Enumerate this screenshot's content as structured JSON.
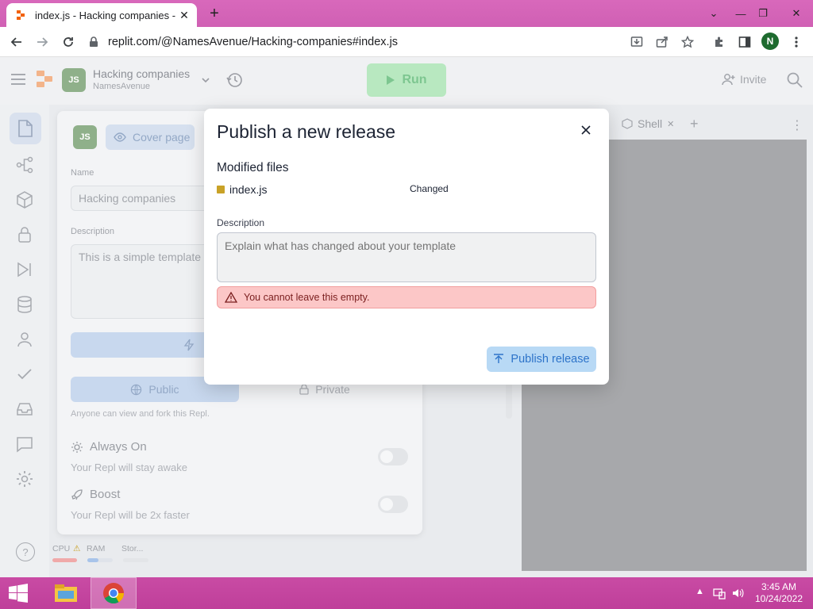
{
  "browser": {
    "tab_title": "index.js - Hacking companies - R",
    "url": "replit.com/@NamesAvenue/Hacking-companies#index.js",
    "profile_initial": "N"
  },
  "app": {
    "repl_title": "Hacking companies",
    "repl_owner": "NamesAvenue",
    "run_label": "Run",
    "invite_label": "Invite",
    "shell_tab": "Shell"
  },
  "panel": {
    "cover_page": "Cover page",
    "name_label": "Name",
    "name_value": "Hacking companies",
    "description_label": "Description",
    "description_value": "This is a simple template",
    "public_label": "Public",
    "private_label": "Private",
    "visibility_note": "Anyone can view and fork this Repl.",
    "always_on_title": "Always On",
    "always_on_sub": "Your Repl will stay awake",
    "boost_title": "Boost",
    "boost_sub": "Your Repl will be 2x faster",
    "cpu": "CPU",
    "ram": "RAM",
    "storage": "Stor..."
  },
  "modal": {
    "title": "Publish a new release",
    "modified_files_label": "Modified files",
    "files": [
      {
        "name": "index.js",
        "status": "Changed"
      }
    ],
    "description_label": "Description",
    "description_placeholder": "Explain what has changed about your template",
    "error_text": "You cannot leave this empty.",
    "publish_button": "Publish release"
  },
  "taskbar": {
    "time": "3:45 AM",
    "date": "10/24/2022"
  },
  "colors": {
    "tabbar": "#d060b4",
    "taskbar": "#c13e9b",
    "error_bg": "#fcc7c7",
    "publish_bg": "#b8d9f5",
    "run_bg": "#b8e8c0"
  }
}
